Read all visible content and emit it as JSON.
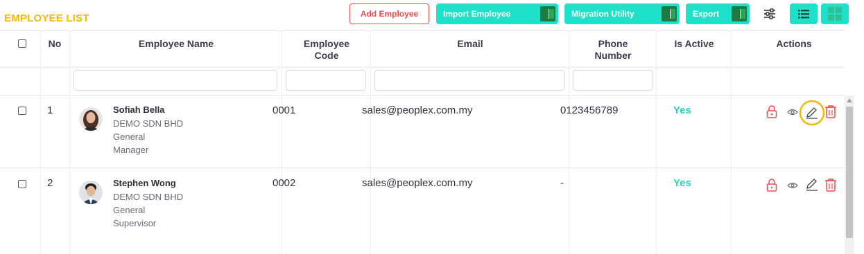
{
  "page": {
    "title": "EMPLOYEE LIST"
  },
  "toolbar": {
    "add_employee": "Add Employee",
    "import_employee": "Import Employee",
    "migration_utility": "Migration Utility",
    "export": "Export",
    "excel_glyph": "X"
  },
  "table": {
    "columns": [
      "No",
      "Employee Name",
      "Employee Code",
      "Email",
      "Phone Number",
      "Is Active",
      "Actions"
    ],
    "col_code_line1": "Employee",
    "col_code_line2": "Code",
    "col_phone_line1": "Phone",
    "col_phone_line2": "Number",
    "rows": [
      {
        "no": "1",
        "name": "Sofiah Bella",
        "company": "DEMO SDN BHD",
        "title_line1": "General",
        "title_line2": "Manager",
        "code": "0001",
        "email": "sales@peoplex.com.my",
        "phone": "0123456789",
        "active": "Yes"
      },
      {
        "no": "2",
        "name": "Stephen Wong",
        "company": "DEMO SDN BHD",
        "title_line1": "General",
        "title_line2": "Supervisor",
        "code": "0002",
        "email": "sales@peoplex.com.my",
        "phone": "-",
        "active": "Yes"
      }
    ]
  },
  "colors": {
    "accent_yellow": "#f5b800",
    "teal": "#1fe0c8",
    "danger": "#ef4a4a",
    "active_green": "#22d6b8"
  },
  "icons": [
    "excel-icon",
    "filter-settings-icon",
    "list-view-icon",
    "grid-view-icon",
    "lock-icon",
    "eye-icon",
    "edit-icon",
    "trash-icon"
  ]
}
